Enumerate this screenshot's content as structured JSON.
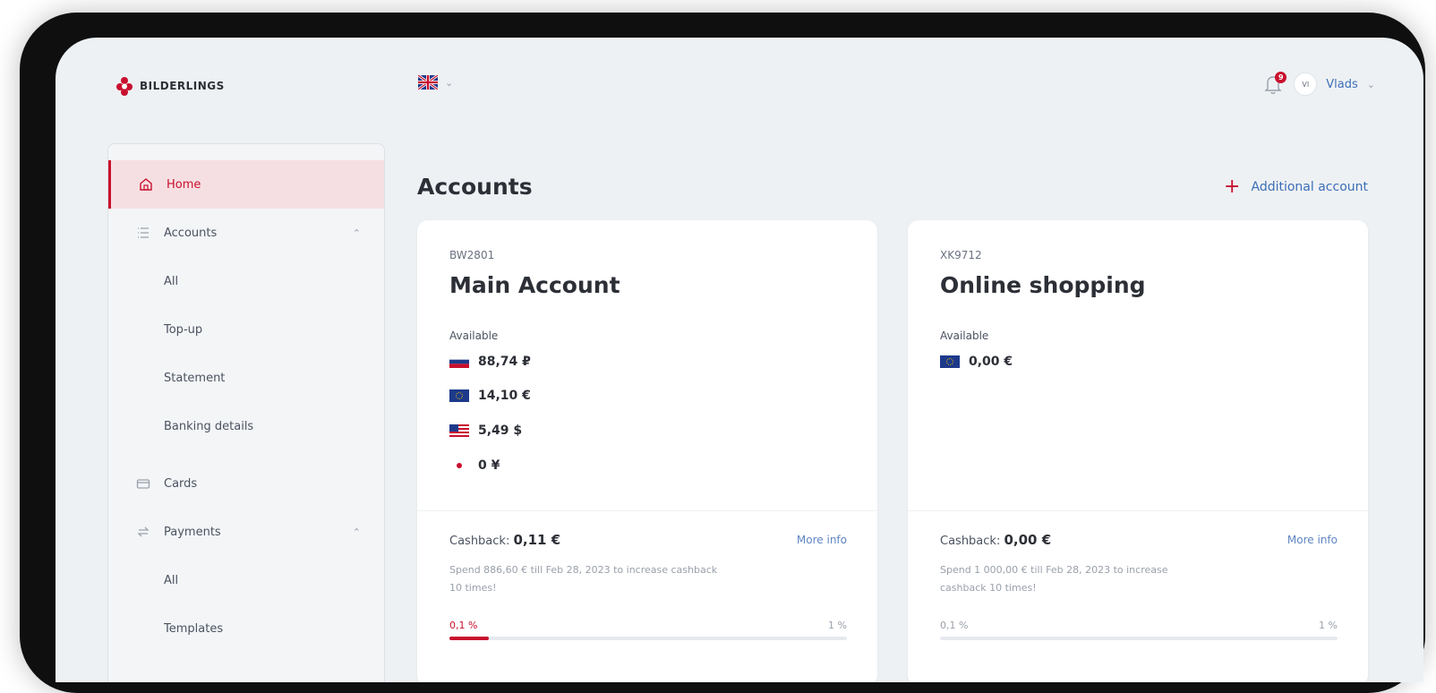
{
  "header": {
    "brand": "BILDERLINGS",
    "notifications_count": "9",
    "avatar_initials": "VI",
    "user_name": "Vlads"
  },
  "sidebar": {
    "items": [
      {
        "label": "Home",
        "icon": "home-icon",
        "active": true
      },
      {
        "label": "Accounts",
        "icon": "list-icon",
        "expanded": true
      },
      {
        "label": "All"
      },
      {
        "label": "Top-up"
      },
      {
        "label": "Statement"
      },
      {
        "label": "Banking details"
      },
      {
        "label": "Cards",
        "icon": "card-icon"
      },
      {
        "label": "Payments",
        "icon": "payments-icon",
        "expanded": true
      },
      {
        "label": "All"
      },
      {
        "label": "Templates"
      }
    ]
  },
  "main": {
    "title": "Accounts",
    "add_account_label": "Additional account",
    "accounts": [
      {
        "id": "BW2801",
        "name": "Main Account",
        "available_label": "Available",
        "balances": [
          {
            "currency": "RUB",
            "amount": "88,74 ₽"
          },
          {
            "currency": "EUR",
            "amount": "14,10 €"
          },
          {
            "currency": "USD",
            "amount": "5,49 $"
          },
          {
            "currency": "JPY",
            "amount": "0 ¥"
          }
        ],
        "cashback_label": "Cashback:",
        "cashback_value": "0,11 €",
        "more_info": "More info",
        "spend_text": "Spend 886,60 € till Feb 28, 2023 to increase cashback 10 times!",
        "pct_min": "0,1 %",
        "pct_max": "1 %",
        "progress": 0.1
      },
      {
        "id": "XK9712",
        "name": "Online shopping",
        "available_label": "Available",
        "balances": [
          {
            "currency": "EUR",
            "amount": "0,00 €"
          }
        ],
        "cashback_label": "Cashback:",
        "cashback_value": "0,00 €",
        "more_info": "More info",
        "spend_text": "Spend 1 000,00 € till Feb 28, 2023 to increase cashback 10 times!",
        "pct_min": "0,1 %",
        "pct_max": "1 %",
        "progress": 0.0
      }
    ]
  },
  "colors": {
    "accent": "#c8102e",
    "link": "#3c6fb6",
    "background": "#eef1f4"
  }
}
